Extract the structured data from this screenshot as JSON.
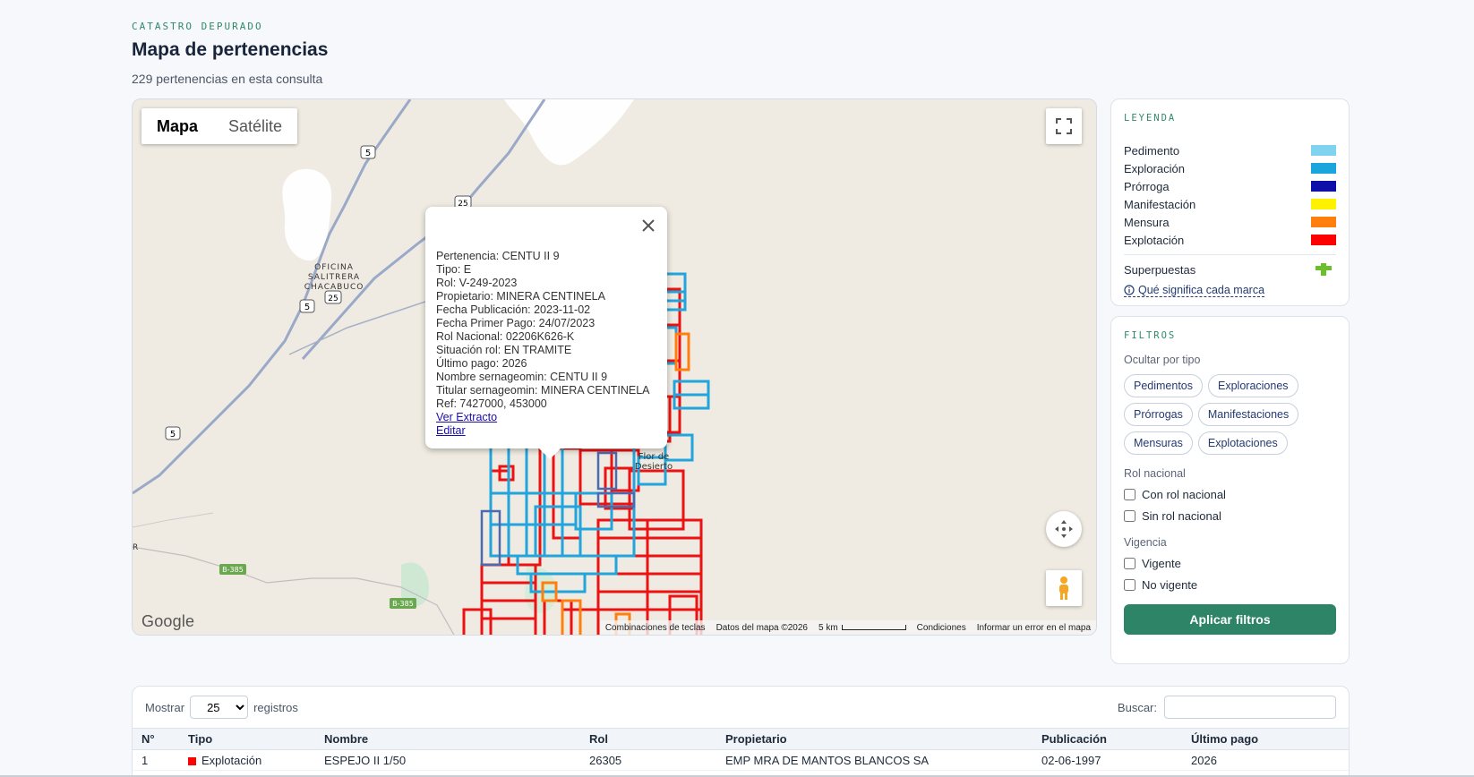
{
  "header": {
    "eyebrow": "CATASTRO DEPURADO",
    "title": "Mapa de pertenencias",
    "subtitle": "229 pertenencias en esta consulta"
  },
  "map": {
    "type_buttons": [
      "Mapa",
      "Satélite"
    ],
    "active_type": "Mapa",
    "place_labels": {
      "oficina_line1": "OFICINA",
      "oficina_line2": "SALITRERA",
      "oficina_line3": "CHACABUCO",
      "flor_line1": "Flor de",
      "flor_line2": "Desierto",
      "r_edge": "R"
    },
    "route_shields": {
      "r5": "5",
      "r25": "25",
      "b385": "B-385"
    },
    "logo": "Google",
    "attribution": {
      "shortcuts": "Combinaciones de teclas",
      "data": "Datos del mapa ©2026",
      "scale": "5 km",
      "terms": "Condiciones",
      "report": "Informar un error en el mapa"
    },
    "popup": {
      "lines": [
        "Pertenencia: CENTU II 9",
        "Tipo: E",
        "Rol: V-249-2023",
        "Propietario: MINERA CENTINELA",
        "Fecha Publicación: 2023-11-02",
        "Fecha Primer Pago: 24/07/2023",
        "Rol Nacional: 02206K626-K",
        "Situación rol: EN TRAMITE",
        "Último pago: 2026",
        "Nombre sernageomin: CENTU II 9",
        "Titular sernageomin: MINERA CENTINELA",
        "Ref: 7427000, 453000"
      ],
      "link_extracto": "Ver Extracto",
      "link_editar": "Editar"
    }
  },
  "legend": {
    "title": "LEYENDA",
    "items": [
      {
        "label": "Pedimento",
        "color": "#7fd3ef"
      },
      {
        "label": "Exploración",
        "color": "#1aa6dc"
      },
      {
        "label": "Prórroga",
        "color": "#0d0fa8"
      },
      {
        "label": "Manifestación",
        "color": "#fff200"
      },
      {
        "label": "Mensura",
        "color": "#ff7f0e"
      },
      {
        "label": "Explotación",
        "color": "#ff0000"
      }
    ],
    "superpuestas_label": "Superpuestas",
    "superpuestas_icon": "green-cross-icon",
    "help_link": "Qué significa cada marca"
  },
  "filters": {
    "title": "FILTROS",
    "hide_by_type_label": "Ocultar por tipo",
    "chips": [
      "Pedimentos",
      "Exploraciones",
      "Prórrogas",
      "Manifestaciones",
      "Mensuras",
      "Explotaciones"
    ],
    "rol_nacional_label": "Rol nacional",
    "rol_options": [
      "Con rol nacional",
      "Sin rol nacional"
    ],
    "vigencia_label": "Vigencia",
    "vigencia_options": [
      "Vigente",
      "No vigente"
    ],
    "apply_label": "Aplicar filtros"
  },
  "table": {
    "show_label": "Mostrar",
    "page_size": "25",
    "records_label": "registros",
    "search_label": "Buscar:",
    "columns": [
      "N°",
      "Tipo",
      "Nombre",
      "Rol",
      "Propietario",
      "Publicación",
      "Último pago"
    ],
    "rows": [
      {
        "n": "1",
        "tipo": "Explotación",
        "tipo_color": "#ff0000",
        "nombre": "ESPEJO II 1/50",
        "rol": "26305",
        "propietario": "EMP MRA DE MANTOS BLANCOS SA",
        "publicacion": "02-06-1997",
        "ultimo_pago": "2026"
      }
    ]
  },
  "colors": {
    "accent": "#2e8466",
    "explotacion": "#ff0000",
    "exploracion": "#1aa6dc",
    "mensura": "#ff7f0e"
  }
}
